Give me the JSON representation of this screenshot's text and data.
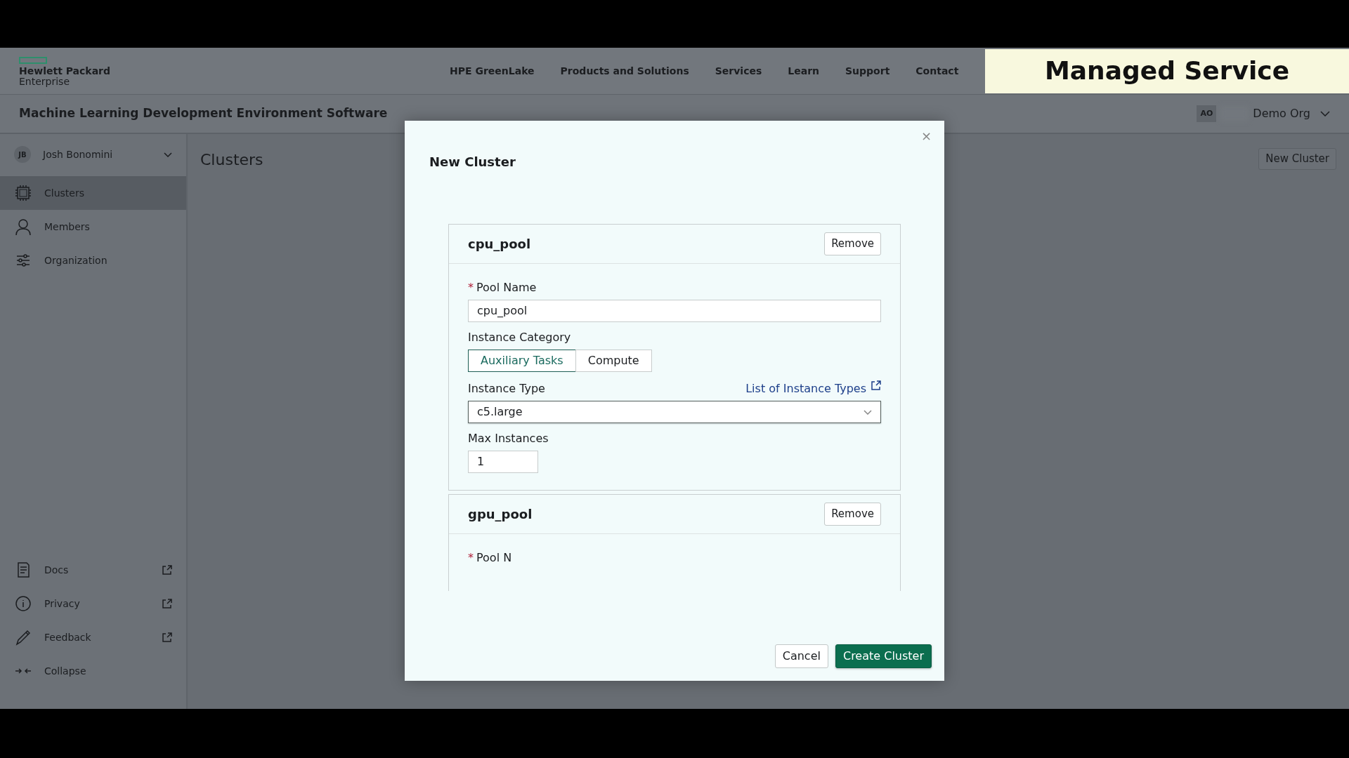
{
  "header": {
    "logo": {
      "line1": "Hewlett Packard",
      "line2": "Enterprise"
    },
    "nav": [
      "HPE GreenLake",
      "Products and Solutions",
      "Services",
      "Learn",
      "Support",
      "Contact"
    ],
    "banner": "Managed Service"
  },
  "subheader": {
    "title": "Machine Learning Development Environment Software",
    "org": {
      "initials": "AO",
      "name": "Demo Org"
    }
  },
  "sidebar": {
    "user": {
      "initials": "JB",
      "name": "Josh Bonomini"
    },
    "items": [
      {
        "label": "Clusters",
        "selected": true
      },
      {
        "label": "Members",
        "selected": false
      },
      {
        "label": "Organization",
        "selected": false
      }
    ],
    "footer_items": [
      {
        "label": "Docs",
        "external": true
      },
      {
        "label": "Privacy",
        "external": true
      },
      {
        "label": "Feedback",
        "external": true
      },
      {
        "label": "Collapse",
        "external": false
      }
    ]
  },
  "page": {
    "title": "Clusters",
    "action": "New Cluster"
  },
  "modal": {
    "title": "New Cluster",
    "close": "×",
    "pools": [
      {
        "name": "cpu_pool",
        "remove": "Remove",
        "pool_name": {
          "label": "Pool Name",
          "required_mark": "*",
          "value": "cpu_pool"
        },
        "instance_category": {
          "label": "Instance Category",
          "options": [
            {
              "label": "Auxiliary Tasks",
              "selected": true
            },
            {
              "label": "Compute",
              "selected": false
            }
          ]
        },
        "instance_type": {
          "label": "Instance Type",
          "link": "List of Instance Types",
          "value": "c5.large"
        },
        "max_instances": {
          "label": "Max Instances",
          "value": "1"
        }
      },
      {
        "name": "gpu_pool",
        "remove": "Remove",
        "pool_name": {
          "label": "Pool N",
          "required_mark": "*"
        }
      }
    ],
    "buttons": [
      {
        "label": "Cancel",
        "kind": "secondary"
      },
      {
        "label": "Create Cluster",
        "kind": "primary"
      }
    ]
  }
}
